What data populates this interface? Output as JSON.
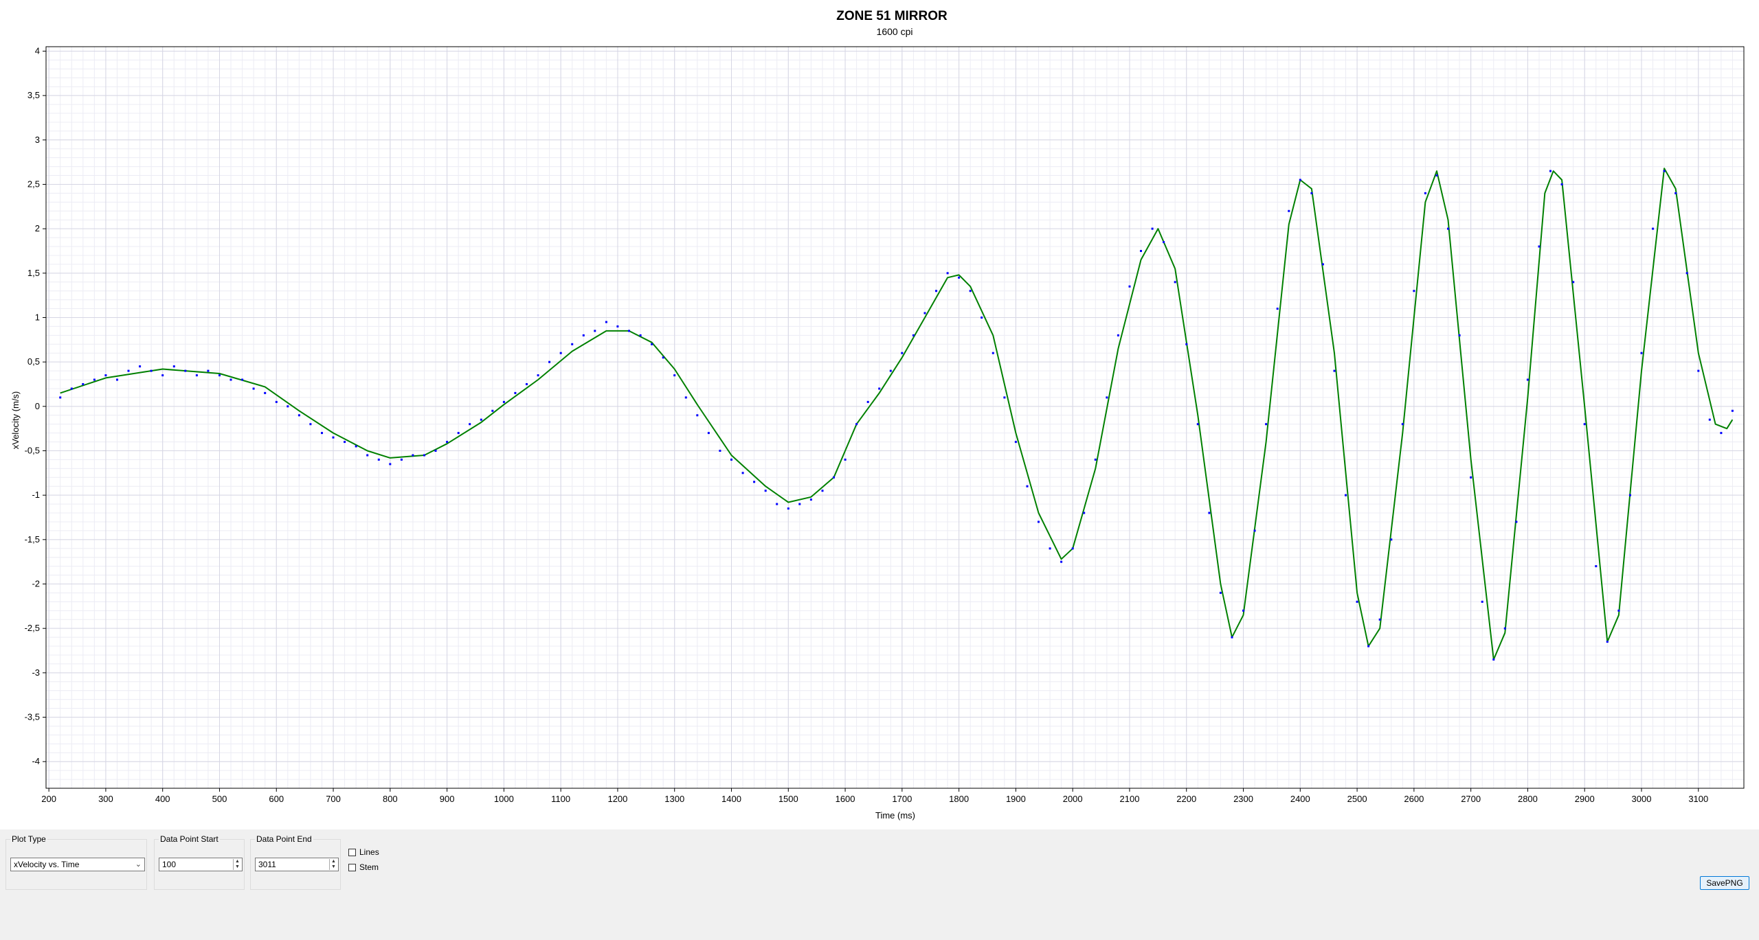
{
  "chart_data": {
    "type": "scatter",
    "title": "ZONE 51 MIRROR",
    "subtitle": "1600 cpi",
    "xlabel": "Time (ms)",
    "ylabel": "xVelocity (m/s)",
    "xlim": [
      195,
      3180
    ],
    "ylim": [
      -4.3,
      4.05
    ],
    "x_ticks": [
      "200",
      "300",
      "400",
      "500",
      "600",
      "700",
      "800",
      "900",
      "1000",
      "1100",
      "1200",
      "1300",
      "1400",
      "1500",
      "1600",
      "1700",
      "1800",
      "1900",
      "2000",
      "2100",
      "2200",
      "2300",
      "2400",
      "2500",
      "2600",
      "2700",
      "2800",
      "2900",
      "3000",
      "3100"
    ],
    "y_ticks": [
      "4",
      "3,5",
      "3",
      "2,5",
      "2",
      "1,5",
      "1",
      "0,5",
      "0",
      "-0,5",
      "-1",
      "-1,5",
      "-2",
      "-2,5",
      "-3",
      "-3,5",
      "-4"
    ],
    "grid": true,
    "series": [
      {
        "kind": "points",
        "color": "#0000ff",
        "x_range": [
          220,
          3160
        ],
        "points": [
          [
            220,
            0.1
          ],
          [
            240,
            0.2
          ],
          [
            260,
            0.25
          ],
          [
            280,
            0.3
          ],
          [
            300,
            0.35
          ],
          [
            320,
            0.3
          ],
          [
            340,
            0.4
          ],
          [
            360,
            0.45
          ],
          [
            380,
            0.4
          ],
          [
            400,
            0.35
          ],
          [
            420,
            0.45
          ],
          [
            440,
            0.4
          ],
          [
            460,
            0.35
          ],
          [
            480,
            0.4
          ],
          [
            500,
            0.35
          ],
          [
            520,
            0.3
          ],
          [
            540,
            0.3
          ],
          [
            560,
            0.2
          ],
          [
            580,
            0.15
          ],
          [
            600,
            0.05
          ],
          [
            620,
            0.0
          ],
          [
            640,
            -0.1
          ],
          [
            660,
            -0.2
          ],
          [
            680,
            -0.3
          ],
          [
            700,
            -0.35
          ],
          [
            720,
            -0.4
          ],
          [
            740,
            -0.45
          ],
          [
            760,
            -0.55
          ],
          [
            780,
            -0.6
          ],
          [
            800,
            -0.65
          ],
          [
            820,
            -0.6
          ],
          [
            840,
            -0.55
          ],
          [
            860,
            -0.55
          ],
          [
            880,
            -0.5
          ],
          [
            900,
            -0.4
          ],
          [
            920,
            -0.3
          ],
          [
            940,
            -0.2
          ],
          [
            960,
            -0.15
          ],
          [
            980,
            -0.05
          ],
          [
            1000,
            0.05
          ],
          [
            1020,
            0.15
          ],
          [
            1040,
            0.25
          ],
          [
            1060,
            0.35
          ],
          [
            1080,
            0.5
          ],
          [
            1100,
            0.6
          ],
          [
            1120,
            0.7
          ],
          [
            1140,
            0.8
          ],
          [
            1160,
            0.85
          ],
          [
            1180,
            0.95
          ],
          [
            1200,
            0.9
          ],
          [
            1220,
            0.85
          ],
          [
            1240,
            0.8
          ],
          [
            1260,
            0.7
          ],
          [
            1280,
            0.55
          ],
          [
            1300,
            0.35
          ],
          [
            1320,
            0.1
          ],
          [
            1340,
            -0.1
          ],
          [
            1360,
            -0.3
          ],
          [
            1380,
            -0.5
          ],
          [
            1400,
            -0.6
          ],
          [
            1420,
            -0.75
          ],
          [
            1440,
            -0.85
          ],
          [
            1460,
            -0.95
          ],
          [
            1480,
            -1.1
          ],
          [
            1500,
            -1.15
          ],
          [
            1520,
            -1.1
          ],
          [
            1540,
            -1.05
          ],
          [
            1560,
            -0.95
          ],
          [
            1580,
            -0.8
          ],
          [
            1600,
            -0.6
          ],
          [
            1620,
            -0.2
          ],
          [
            1640,
            0.05
          ],
          [
            1660,
            0.2
          ],
          [
            1680,
            0.4
          ],
          [
            1700,
            0.6
          ],
          [
            1720,
            0.8
          ],
          [
            1740,
            1.05
          ],
          [
            1760,
            1.3
          ],
          [
            1780,
            1.5
          ],
          [
            1800,
            1.45
          ],
          [
            1820,
            1.3
          ],
          [
            1840,
            1.0
          ],
          [
            1860,
            0.6
          ],
          [
            1880,
            0.1
          ],
          [
            1900,
            -0.4
          ],
          [
            1920,
            -0.9
          ],
          [
            1940,
            -1.3
          ],
          [
            1960,
            -1.6
          ],
          [
            1980,
            -1.75
          ],
          [
            2000,
            -1.6
          ],
          [
            2020,
            -1.2
          ],
          [
            2040,
            -0.6
          ],
          [
            2060,
            0.1
          ],
          [
            2080,
            0.8
          ],
          [
            2100,
            1.35
          ],
          [
            2120,
            1.75
          ],
          [
            2140,
            2.0
          ],
          [
            2160,
            1.85
          ],
          [
            2180,
            1.4
          ],
          [
            2200,
            0.7
          ],
          [
            2220,
            -0.2
          ],
          [
            2240,
            -1.2
          ],
          [
            2260,
            -2.1
          ],
          [
            2280,
            -2.6
          ],
          [
            2300,
            -2.3
          ],
          [
            2320,
            -1.4
          ],
          [
            2340,
            -0.2
          ],
          [
            2360,
            1.1
          ],
          [
            2380,
            2.2
          ],
          [
            2400,
            2.55
          ],
          [
            2420,
            2.4
          ],
          [
            2440,
            1.6
          ],
          [
            2460,
            0.4
          ],
          [
            2480,
            -1.0
          ],
          [
            2500,
            -2.2
          ],
          [
            2520,
            -2.7
          ],
          [
            2540,
            -2.4
          ],
          [
            2560,
            -1.5
          ],
          [
            2580,
            -0.2
          ],
          [
            2600,
            1.3
          ],
          [
            2620,
            2.4
          ],
          [
            2640,
            2.6
          ],
          [
            2660,
            2.0
          ],
          [
            2680,
            0.8
          ],
          [
            2700,
            -0.8
          ],
          [
            2720,
            -2.2
          ],
          [
            2740,
            -2.85
          ],
          [
            2760,
            -2.5
          ],
          [
            2780,
            -1.3
          ],
          [
            2800,
            0.3
          ],
          [
            2820,
            1.8
          ],
          [
            2840,
            2.65
          ],
          [
            2860,
            2.5
          ],
          [
            2880,
            1.4
          ],
          [
            2900,
            -0.2
          ],
          [
            2920,
            -1.8
          ],
          [
            2940,
            -2.65
          ],
          [
            2960,
            -2.3
          ],
          [
            2980,
            -1.0
          ],
          [
            3000,
            0.6
          ],
          [
            3020,
            2.0
          ],
          [
            3040,
            2.65
          ],
          [
            3060,
            2.4
          ],
          [
            3080,
            1.5
          ],
          [
            3100,
            0.4
          ],
          [
            3120,
            -0.15
          ],
          [
            3140,
            -0.3
          ],
          [
            3160,
            -0.05
          ]
        ]
      },
      {
        "kind": "line",
        "color": "#008000",
        "points": [
          [
            220,
            0.15
          ],
          [
            300,
            0.32
          ],
          [
            400,
            0.42
          ],
          [
            500,
            0.37
          ],
          [
            580,
            0.22
          ],
          [
            640,
            -0.05
          ],
          [
            700,
            -0.3
          ],
          [
            760,
            -0.5
          ],
          [
            800,
            -0.58
          ],
          [
            860,
            -0.55
          ],
          [
            900,
            -0.42
          ],
          [
            960,
            -0.18
          ],
          [
            1000,
            0.02
          ],
          [
            1060,
            0.3
          ],
          [
            1120,
            0.62
          ],
          [
            1180,
            0.85
          ],
          [
            1220,
            0.85
          ],
          [
            1260,
            0.72
          ],
          [
            1300,
            0.42
          ],
          [
            1340,
            0.02
          ],
          [
            1400,
            -0.55
          ],
          [
            1460,
            -0.9
          ],
          [
            1500,
            -1.08
          ],
          [
            1540,
            -1.02
          ],
          [
            1580,
            -0.8
          ],
          [
            1620,
            -0.2
          ],
          [
            1660,
            0.15
          ],
          [
            1700,
            0.55
          ],
          [
            1740,
            1.0
          ],
          [
            1780,
            1.45
          ],
          [
            1800,
            1.48
          ],
          [
            1820,
            1.35
          ],
          [
            1860,
            0.8
          ],
          [
            1900,
            -0.3
          ],
          [
            1940,
            -1.2
          ],
          [
            1980,
            -1.72
          ],
          [
            2000,
            -1.6
          ],
          [
            2040,
            -0.7
          ],
          [
            2080,
            0.65
          ],
          [
            2120,
            1.65
          ],
          [
            2150,
            2.0
          ],
          [
            2180,
            1.55
          ],
          [
            2220,
            -0.1
          ],
          [
            2260,
            -2.0
          ],
          [
            2280,
            -2.6
          ],
          [
            2300,
            -2.35
          ],
          [
            2340,
            -0.4
          ],
          [
            2380,
            2.05
          ],
          [
            2400,
            2.55
          ],
          [
            2420,
            2.45
          ],
          [
            2460,
            0.6
          ],
          [
            2500,
            -2.1
          ],
          [
            2520,
            -2.7
          ],
          [
            2540,
            -2.5
          ],
          [
            2580,
            -0.3
          ],
          [
            2620,
            2.3
          ],
          [
            2640,
            2.65
          ],
          [
            2660,
            2.1
          ],
          [
            2700,
            -0.6
          ],
          [
            2740,
            -2.85
          ],
          [
            2760,
            -2.55
          ],
          [
            2800,
            0.1
          ],
          [
            2830,
            2.4
          ],
          [
            2845,
            2.65
          ],
          [
            2860,
            2.55
          ],
          [
            2900,
            0.0
          ],
          [
            2940,
            -2.65
          ],
          [
            2960,
            -2.35
          ],
          [
            3000,
            0.4
          ],
          [
            3040,
            2.68
          ],
          [
            3060,
            2.45
          ],
          [
            3100,
            0.6
          ],
          [
            3130,
            -0.2
          ],
          [
            3150,
            -0.25
          ],
          [
            3160,
            -0.15
          ]
        ]
      }
    ]
  },
  "controls": {
    "plot_type_label": "Plot Type",
    "plot_type_value": "xVelocity vs. Time",
    "start_label": "Data Point Start",
    "start_value": "100",
    "end_label": "Data Point End",
    "end_value": "3011",
    "lines_label": "Lines",
    "stem_label": "Stem",
    "save_label": "SavePNG"
  }
}
